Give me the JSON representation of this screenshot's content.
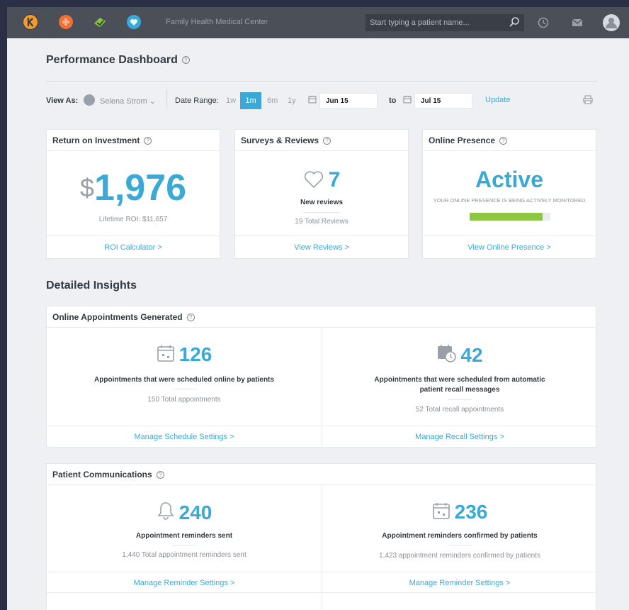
{
  "topbar": {
    "app_title": "Family Health Medical Center",
    "search_placeholder": "Start typing a patient name...",
    "icons": [
      "k-logo-icon",
      "bandage-icon",
      "dollar-icon",
      "heart-shield-icon",
      "search-icon",
      "history-icon",
      "mail-icon",
      "user-avatar-icon"
    ],
    "colors": {
      "k_logo": "#f39a2a",
      "bandage": "#f06f38",
      "dollar": "#8bc34a",
      "heart": "#3aa9d6"
    }
  },
  "page": {
    "title": "Performance Dashboard",
    "help_glyph": "?"
  },
  "filters": {
    "view_as_label": "View As:",
    "user_name": "Selena Strom",
    "user_caret": "⌄",
    "date_range_label": "Date Range:",
    "ranges": [
      "1w",
      "1m",
      "6m",
      "1y"
    ],
    "selected_range": "1m",
    "from_date": "Jun 15",
    "to_label": "to",
    "to_date": "Jul 15",
    "update_label": "Update",
    "icons": [
      "calendar-icon",
      "printer-icon"
    ]
  },
  "roi": {
    "title": "Return on Investment",
    "currency": "$",
    "value": "1,976",
    "lifetime": "Lifetime ROI: $11,657",
    "link": "ROI Calculator >"
  },
  "surveys": {
    "title": "Surveys & Reviews",
    "value": "7",
    "label": "New reviews",
    "total": "19 Total Reviews",
    "link": "View Reviews >"
  },
  "presence": {
    "title": "Online Presence",
    "status": "Active",
    "caption": "YOUR ONLINE PRESENCE IS BEING ACTIVELY MONITORED",
    "progress": 0.9,
    "bar_color": "#8dc63f",
    "link": "View Online Presence >"
  },
  "insights_title": "Detailed Insights",
  "appointments": {
    "title": "Online Appointments Generated",
    "left": {
      "value": "126",
      "label": "Appointments that were scheduled online by patients",
      "total": "150 Total appointments",
      "link": "Manage Schedule Settings >"
    },
    "right": {
      "value": "42",
      "label_line1": "Appointments that were scheduled from automatic",
      "label_line2": "patient recall messages",
      "total": "52 Total recall appointments",
      "link": "Manage Recall Settings >"
    }
  },
  "communications": {
    "title": "Patient Communications",
    "left": {
      "value": "240",
      "label": "Appointment reminders sent",
      "total": "1,440 Total appointment reminders sent",
      "link": "Manage Reminder Settings >"
    },
    "right": {
      "value": "236",
      "label": "Appointment reminders confirmed by patients",
      "total": "1,423 appointment reminders confirmed by patients",
      "link": "Manage Reminder Settings >"
    }
  }
}
